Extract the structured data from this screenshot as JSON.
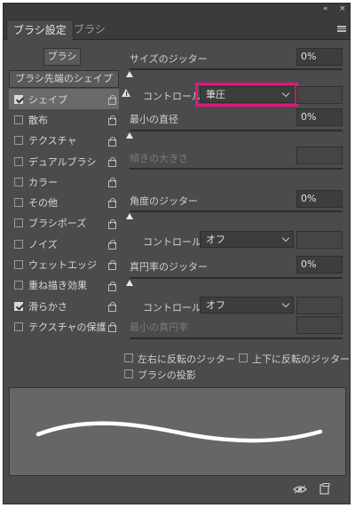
{
  "window": {
    "collapse_glyph": "«",
    "close_glyph": "×"
  },
  "tabs": {
    "active": "ブラシ設定",
    "inactive": "ブラシ"
  },
  "left": {
    "brush_button": "ブラシ",
    "tip_shape_button": "ブラシ先端のシェイプ",
    "items": [
      {
        "label": "シェイプ",
        "checked": true,
        "selected": true
      },
      {
        "label": "散布",
        "checked": false
      },
      {
        "label": "テクスチャ",
        "checked": false
      },
      {
        "label": "デュアルブラシ",
        "checked": false
      },
      {
        "label": "カラー",
        "checked": false
      },
      {
        "label": "その他",
        "checked": false
      },
      {
        "label": "ブラシポーズ",
        "checked": false
      },
      {
        "label": "ノイズ",
        "checked": false
      },
      {
        "label": "ウェットエッジ",
        "checked": false
      },
      {
        "label": "重ね描き効果",
        "checked": false
      },
      {
        "label": "滑らかさ",
        "checked": true
      },
      {
        "label": "テクスチャの保護",
        "checked": false
      }
    ]
  },
  "right": {
    "size_jitter": {
      "label": "サイズのジッター",
      "value": "0%"
    },
    "control1": {
      "label": "コントロール：",
      "value": "筆圧"
    },
    "min_diameter": {
      "label": "最小の直径",
      "value": "0%"
    },
    "tilt_scale": {
      "label": "傾きの大きさ"
    },
    "angle_jitter": {
      "label": "角度のジッター",
      "value": "0%"
    },
    "control2": {
      "label": "コントロール：",
      "value": "オフ"
    },
    "roundness_jitter": {
      "label": "真円率のジッター",
      "value": "0%"
    },
    "control3": {
      "label": "コントロール：",
      "value": "オフ"
    },
    "min_roundness": {
      "label": "最小の真円率"
    },
    "flip_x": "左右に反転のジッター",
    "flip_y": "上下に反転のジッター",
    "projection": "ブラシの投影"
  },
  "colors": {
    "highlight": "#e4157e",
    "panel": "#4b4b4b"
  }
}
